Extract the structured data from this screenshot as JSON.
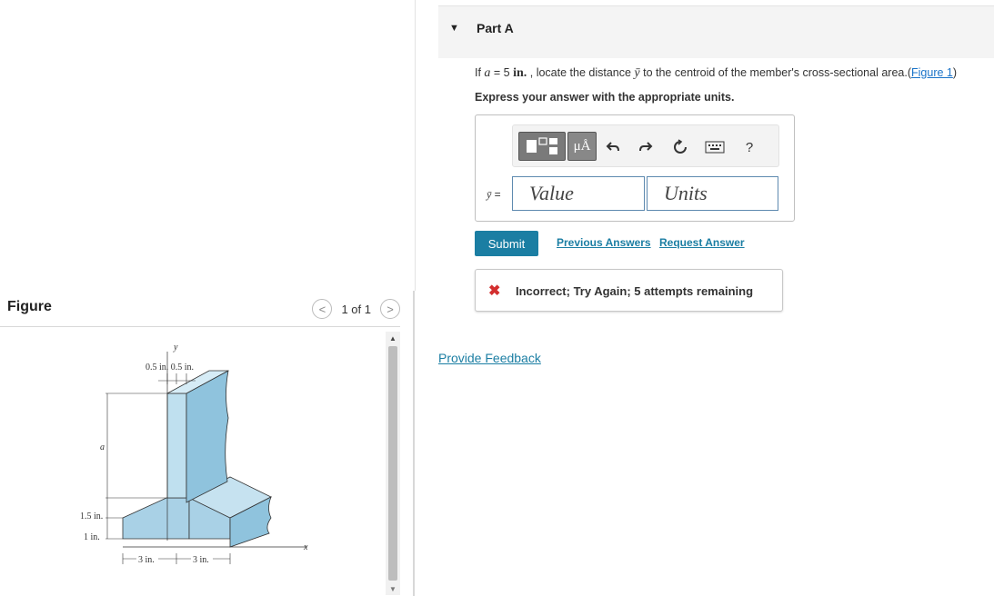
{
  "figure_panel": {
    "title": "Figure",
    "pager_text": "1 of 1",
    "prev_glyph": "<",
    "next_glyph": ">"
  },
  "diagram": {
    "labels": {
      "y_axis": "y",
      "x_axis": "x",
      "top_dims": "0.5 in. 0.5 in.",
      "a": "a",
      "d15": "1.5 in.",
      "d1": "1 in.",
      "b1": "3 in.",
      "b2": "3 in."
    }
  },
  "part": {
    "title": "Part A",
    "caret_icon": "triangle-down-icon"
  },
  "question": {
    "prefix": "If ",
    "var_a": "a",
    "eq": " = 5 ",
    "unit": "in.",
    "middle": " , locate the distance ",
    "var_y": "ȳ",
    "suffix": " to the centroid of the member's cross-sectional area.",
    "figure_link": "Figure 1",
    "paren_open": "(",
    "paren_close": ")"
  },
  "instruction": "Express your answer with the appropriate units.",
  "answer": {
    "var_label": "ȳ",
    "eq": " =",
    "value_placeholder": "Value",
    "units_placeholder": "Units",
    "toolbar": {
      "units_btn": "μÅ",
      "help": "?",
      "icons": [
        "template-icon",
        "units-icon",
        "undo-icon",
        "redo-icon",
        "reset-icon",
        "keyboard-icon",
        "help-icon"
      ]
    }
  },
  "actions": {
    "submit": "Submit",
    "previous_answers": "Previous Answers",
    "request_answer": "Request Answer"
  },
  "feedback": {
    "icon": "✖",
    "text": "Incorrect; Try Again; 5 attempts remaining"
  },
  "provide_feedback": "Provide Feedback",
  "colors": {
    "link": "#1b7ea3",
    "submit_bg": "#1b7ea3",
    "error": "#d32f2f",
    "figure_fill": "#9ecae1"
  }
}
